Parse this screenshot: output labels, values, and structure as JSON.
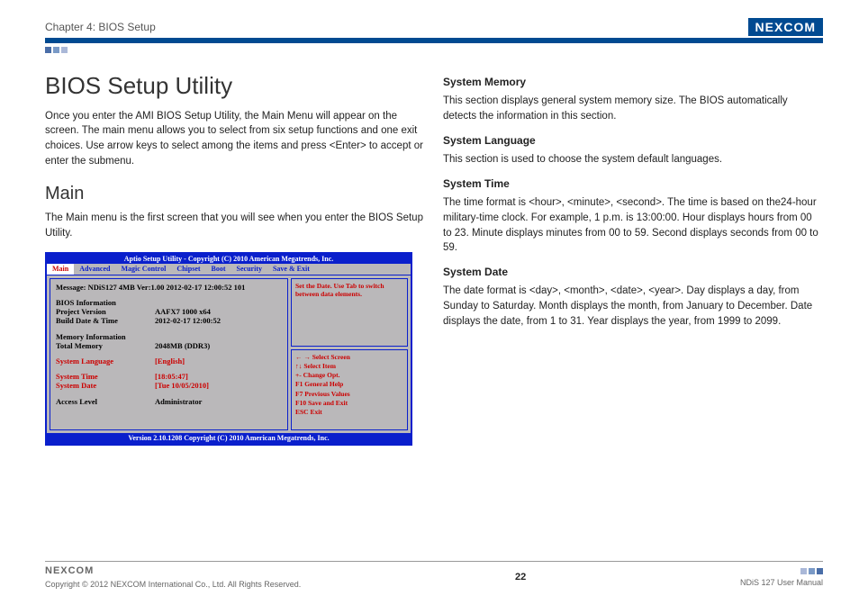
{
  "header": {
    "chapter": "Chapter 4: BIOS Setup",
    "brand": "NEXCOM"
  },
  "left": {
    "h1": "BIOS Setup Utility",
    "intro": "Once you enter the AMI BIOS Setup Utility, the Main Menu will appear on the screen. The main menu allows you to select from six setup functions and one exit choices. Use arrow keys to select among the items and press <Enter> to accept or enter the submenu.",
    "h2": "Main",
    "main_p": "The Main menu is the first screen that you will see when you enter the BIOS Setup Utility."
  },
  "bios": {
    "title": "Aptio Setup  Utility - Copyright (C) 2010 American Megatrends, Inc.",
    "menu": [
      "Main",
      "Advanced",
      "Magic Control",
      "Chipset",
      "Boot",
      "Security",
      "Save & Exit"
    ],
    "message": "Message: NDiS127 4MB Ver:1.00 2012-02-17 12:00:52 101",
    "info_hdr": "BIOS Information",
    "proj_lbl": "Project Version",
    "proj_val": "AAFX7 1000 x64",
    "build_lbl": "Build Date & Time",
    "build_val": "2012-02-17 12:00:52",
    "mem_hdr": "Memory Information",
    "mem_lbl": "Total Memory",
    "mem_val": "2048MB (DDR3)",
    "lang_lbl": "System Language",
    "lang_val": "[English]",
    "time_lbl": "System   Time",
    "time_val": "[18:05:47]",
    "date_lbl": "System   Date",
    "date_val": "[Tue  10/05/2010]",
    "access_lbl": "Access Level",
    "access_val": "Administrator",
    "help": "Set the Date. Use Tab to switch between data elements.",
    "keys": [
      "← →     Select Screen",
      "↑↓       Select Item",
      "+-        Change Opt.",
      "F1        General Help",
      "F7        Previous Values",
      "F10      Save and Exit",
      "ESC     Exit"
    ],
    "footer": "Version 2.10.1208 Copyright (C) 2010 American Megatrends, Inc."
  },
  "right": {
    "s1h": "System Memory",
    "s1p": "This section displays general system memory size. The BIOS automatically detects the information in this section.",
    "s2h": "System Language",
    "s2p": "This section is used to choose the system default languages.",
    "s3h": "System Time",
    "s3p": "The time format is <hour>, <minute>, <second>. The time is based on the24-hour military-time clock. For example, 1 p.m. is 13:00:00. Hour displays hours from 00 to 23. Minute displays minutes from 00 to 59. Second displays seconds from 00 to 59.",
    "s4h": "System Date",
    "s4p": "The date format is <day>, <month>, <date>, <year>. Day displays a day, from Sunday to Saturday. Month displays the month, from January to December. Date displays the date, from 1 to 31. Year displays the year, from 1999 to 2099."
  },
  "footer": {
    "brand": "NEXCOM",
    "copyright": "Copyright © 2012 NEXCOM International Co., Ltd. All Rights Reserved.",
    "page": "22",
    "doc": "NDiS 127 User Manual"
  }
}
